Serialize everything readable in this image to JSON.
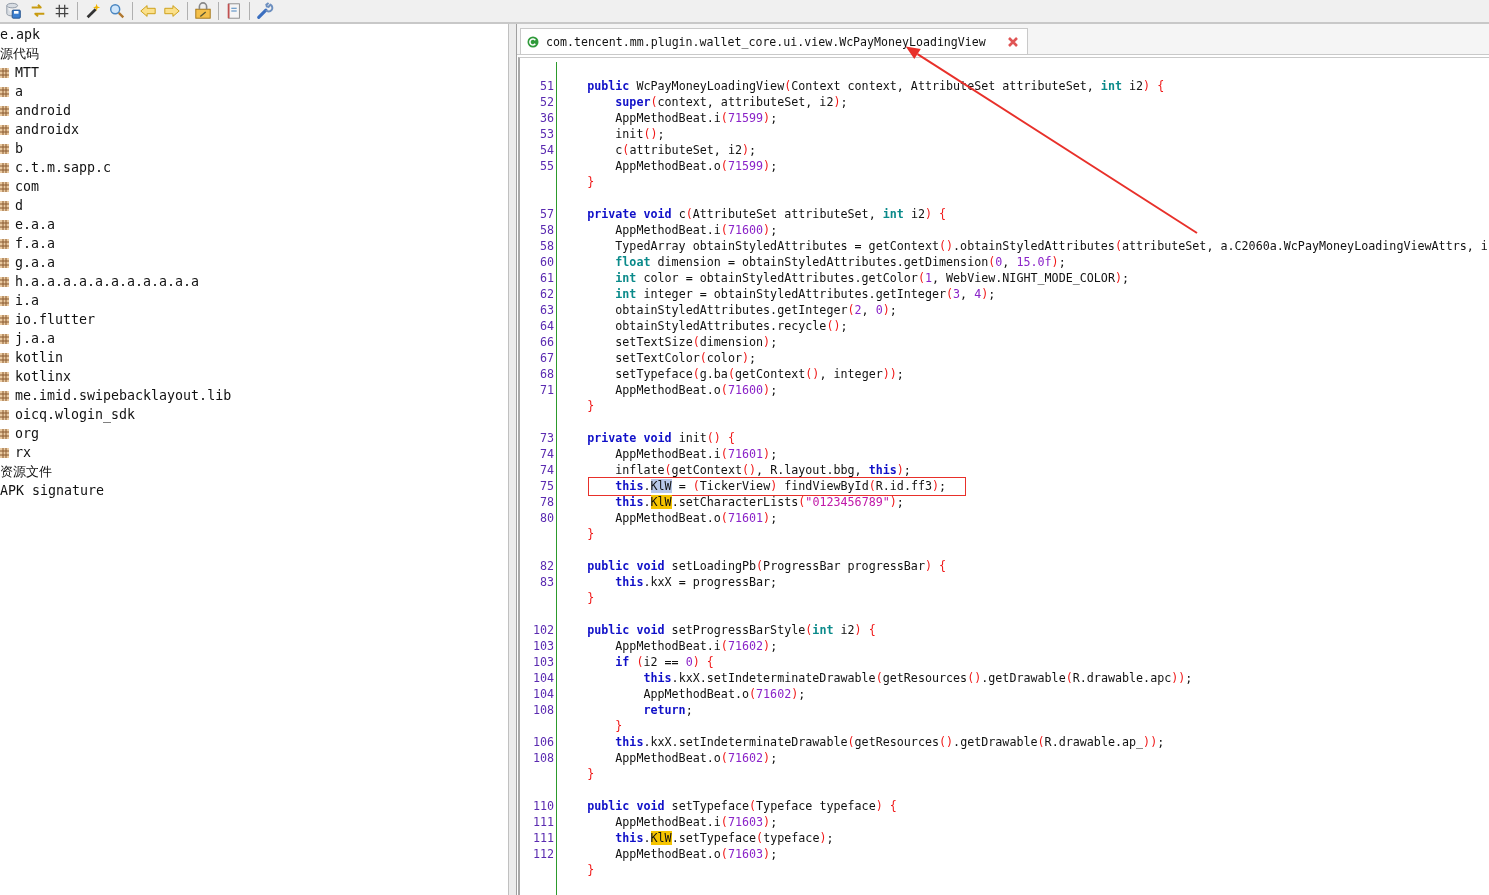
{
  "toolbar": {
    "buttons": [
      {
        "kind": "save"
      },
      {
        "kind": "sync"
      },
      {
        "kind": "grid"
      },
      {
        "kind": "sep"
      },
      {
        "kind": "wand"
      },
      {
        "kind": "search"
      },
      {
        "kind": "sep"
      },
      {
        "kind": "back"
      },
      {
        "kind": "forward"
      },
      {
        "kind": "sep"
      },
      {
        "kind": "box"
      },
      {
        "kind": "sep"
      },
      {
        "kind": "doc"
      },
      {
        "kind": "sep"
      },
      {
        "kind": "wrench"
      }
    ]
  },
  "tree": {
    "items": [
      {
        "kind": "node",
        "label": "e.apk"
      },
      {
        "kind": "node",
        "label": "源代码"
      },
      {
        "kind": "package",
        "label": "MTT"
      },
      {
        "kind": "package",
        "label": "a"
      },
      {
        "kind": "package",
        "label": "android"
      },
      {
        "kind": "package",
        "label": "androidx"
      },
      {
        "kind": "package",
        "label": "b"
      },
      {
        "kind": "package",
        "label": "c.t.m.sapp.c"
      },
      {
        "kind": "package",
        "label": "com"
      },
      {
        "kind": "package",
        "label": "d"
      },
      {
        "kind": "package",
        "label": "e.a.a"
      },
      {
        "kind": "package",
        "label": "f.a.a"
      },
      {
        "kind": "package",
        "label": "g.a.a"
      },
      {
        "kind": "package",
        "label": "h.a.a.a.a.a.a.a.a.a.a.a"
      },
      {
        "kind": "package",
        "label": "i.a"
      },
      {
        "kind": "package",
        "label": "io.flutter"
      },
      {
        "kind": "package",
        "label": "j.a.a"
      },
      {
        "kind": "package",
        "label": "kotlin"
      },
      {
        "kind": "package",
        "label": "kotlinx"
      },
      {
        "kind": "package",
        "label": "me.imid.swipebacklayout.lib"
      },
      {
        "kind": "package",
        "label": "oicq.wlogin_sdk"
      },
      {
        "kind": "package",
        "label": "org"
      },
      {
        "kind": "package",
        "label": "rx"
      },
      {
        "kind": "node",
        "label": "资源文件"
      },
      {
        "kind": "node",
        "label": "APK signature"
      }
    ]
  },
  "tabs": [
    {
      "title": "com.tencent.mm.plugin.wallet_core.ui.view.WcPayMoneyLoadingView",
      "selected": true,
      "arrow": true
    }
  ],
  "code": {
    "lines": [
      {
        "kind": "blank"
      },
      {
        "kind": "code",
        "num": "51",
        "tokens": [
          {
            "kind": "kw",
            "text": "    public"
          },
          {
            "kind": "plain",
            "text": " WcPayMoneyLoadingView"
          },
          {
            "kind": "paren",
            "text": "("
          },
          {
            "kind": "plain",
            "text": "Context context, AttributeSet attributeSet, "
          },
          {
            "kind": "type",
            "text": "int"
          },
          {
            "kind": "plain",
            "text": " i2"
          },
          {
            "kind": "paren",
            "text": ") {"
          }
        ]
      },
      {
        "kind": "code",
        "num": "52",
        "tokens": [
          {
            "kind": "kw",
            "text": "        super"
          },
          {
            "kind": "paren",
            "text": "("
          },
          {
            "kind": "plain",
            "text": "context, attributeSet, i2"
          },
          {
            "kind": "paren",
            "text": ")"
          },
          {
            "kind": "plain",
            "text": ";"
          }
        ]
      },
      {
        "kind": "code",
        "num": "36",
        "tokens": [
          {
            "kind": "plain",
            "text": "        AppMethodBeat.i"
          },
          {
            "kind": "paren",
            "text": "("
          },
          {
            "kind": "num",
            "text": "71599"
          },
          {
            "kind": "paren",
            "text": ")"
          },
          {
            "kind": "plain",
            "text": ";"
          }
        ]
      },
      {
        "kind": "code",
        "num": "53",
        "tokens": [
          {
            "kind": "plain",
            "text": "        init"
          },
          {
            "kind": "paren",
            "text": "()"
          },
          {
            "kind": "plain",
            "text": ";"
          }
        ]
      },
      {
        "kind": "code",
        "num": "54",
        "tokens": [
          {
            "kind": "plain",
            "text": "        c"
          },
          {
            "kind": "paren",
            "text": "("
          },
          {
            "kind": "plain",
            "text": "attributeSet, i2"
          },
          {
            "kind": "paren",
            "text": ")"
          },
          {
            "kind": "plain",
            "text": ";"
          }
        ]
      },
      {
        "kind": "code",
        "num": "55",
        "tokens": [
          {
            "kind": "plain",
            "text": "        AppMethodBeat.o"
          },
          {
            "kind": "paren",
            "text": "("
          },
          {
            "kind": "num",
            "text": "71599"
          },
          {
            "kind": "paren",
            "text": ")"
          },
          {
            "kind": "plain",
            "text": ";"
          }
        ]
      },
      {
        "kind": "code",
        "tokens": [
          {
            "kind": "paren",
            "text": "    }"
          }
        ]
      },
      {
        "kind": "blank"
      },
      {
        "kind": "code",
        "num": "57",
        "tokens": [
          {
            "kind": "kw",
            "text": "    private void"
          },
          {
            "kind": "plain",
            "text": " c"
          },
          {
            "kind": "paren",
            "text": "("
          },
          {
            "kind": "plain",
            "text": "AttributeSet attributeSet, "
          },
          {
            "kind": "type",
            "text": "int"
          },
          {
            "kind": "plain",
            "text": " i2"
          },
          {
            "kind": "paren",
            "text": ") {"
          }
        ]
      },
      {
        "kind": "code",
        "num": "58",
        "tokens": [
          {
            "kind": "plain",
            "text": "        AppMethodBeat.i"
          },
          {
            "kind": "paren",
            "text": "("
          },
          {
            "kind": "num",
            "text": "71600"
          },
          {
            "kind": "paren",
            "text": ")"
          },
          {
            "kind": "plain",
            "text": ";"
          }
        ]
      },
      {
        "kind": "code",
        "num": "58",
        "tokens": [
          {
            "kind": "plain",
            "text": "        TypedArray obtainStyledAttributes = getContext"
          },
          {
            "kind": "paren",
            "text": "()"
          },
          {
            "kind": "plain",
            "text": ".obtainStyledAttributes"
          },
          {
            "kind": "paren",
            "text": "("
          },
          {
            "kind": "plain",
            "text": "attributeSet, a.C2060a.WcPayMoneyLoadingViewAttrs, i"
          }
        ]
      },
      {
        "kind": "code",
        "num": "60",
        "tokens": [
          {
            "kind": "type",
            "text": "        float"
          },
          {
            "kind": "plain",
            "text": " dimension = obtainStyledAttributes.getDimension"
          },
          {
            "kind": "paren",
            "text": "("
          },
          {
            "kind": "num",
            "text": "0"
          },
          {
            "kind": "plain",
            "text": ", "
          },
          {
            "kind": "num",
            "text": "15.0f"
          },
          {
            "kind": "paren",
            "text": ")"
          },
          {
            "kind": "plain",
            "text": ";"
          }
        ]
      },
      {
        "kind": "code",
        "num": "61",
        "tokens": [
          {
            "kind": "type",
            "text": "        int"
          },
          {
            "kind": "plain",
            "text": " color = obtainStyledAttributes.getColor"
          },
          {
            "kind": "paren",
            "text": "("
          },
          {
            "kind": "num",
            "text": "1"
          },
          {
            "kind": "plain",
            "text": ", WebView.NIGHT_MODE_COLOR"
          },
          {
            "kind": "paren",
            "text": ")"
          },
          {
            "kind": "plain",
            "text": ";"
          }
        ]
      },
      {
        "kind": "code",
        "num": "62",
        "tokens": [
          {
            "kind": "type",
            "text": "        int"
          },
          {
            "kind": "plain",
            "text": " integer = obtainStyledAttributes.getInteger"
          },
          {
            "kind": "paren",
            "text": "("
          },
          {
            "kind": "num",
            "text": "3"
          },
          {
            "kind": "plain",
            "text": ", "
          },
          {
            "kind": "num",
            "text": "4"
          },
          {
            "kind": "paren",
            "text": ")"
          },
          {
            "kind": "plain",
            "text": ";"
          }
        ]
      },
      {
        "kind": "code",
        "num": "63",
        "tokens": [
          {
            "kind": "plain",
            "text": "        obtainStyledAttributes.getInteger"
          },
          {
            "kind": "paren",
            "text": "("
          },
          {
            "kind": "num",
            "text": "2"
          },
          {
            "kind": "plain",
            "text": ", "
          },
          {
            "kind": "num",
            "text": "0"
          },
          {
            "kind": "paren",
            "text": ")"
          },
          {
            "kind": "plain",
            "text": ";"
          }
        ]
      },
      {
        "kind": "code",
        "num": "64",
        "tokens": [
          {
            "kind": "plain",
            "text": "        obtainStyledAttributes.recycle"
          },
          {
            "kind": "paren",
            "text": "()"
          },
          {
            "kind": "plain",
            "text": ";"
          }
        ]
      },
      {
        "kind": "code",
        "num": "66",
        "tokens": [
          {
            "kind": "plain",
            "text": "        setTextSize"
          },
          {
            "kind": "paren",
            "text": "("
          },
          {
            "kind": "plain",
            "text": "dimension"
          },
          {
            "kind": "paren",
            "text": ")"
          },
          {
            "kind": "plain",
            "text": ";"
          }
        ]
      },
      {
        "kind": "code",
        "num": "67",
        "tokens": [
          {
            "kind": "plain",
            "text": "        setTextColor"
          },
          {
            "kind": "paren",
            "text": "("
          },
          {
            "kind": "plain",
            "text": "color"
          },
          {
            "kind": "paren",
            "text": ")"
          },
          {
            "kind": "plain",
            "text": ";"
          }
        ]
      },
      {
        "kind": "code",
        "num": "68",
        "tokens": [
          {
            "kind": "plain",
            "text": "        setTypeface"
          },
          {
            "kind": "paren",
            "text": "("
          },
          {
            "kind": "plain",
            "text": "g.ba"
          },
          {
            "kind": "paren",
            "text": "("
          },
          {
            "kind": "plain",
            "text": "getContext"
          },
          {
            "kind": "paren",
            "text": "()"
          },
          {
            "kind": "plain",
            "text": ", integer"
          },
          {
            "kind": "paren",
            "text": "))"
          },
          {
            "kind": "plain",
            "text": ";"
          }
        ]
      },
      {
        "kind": "code",
        "num": "71",
        "tokens": [
          {
            "kind": "plain",
            "text": "        AppMethodBeat.o"
          },
          {
            "kind": "paren",
            "text": "("
          },
          {
            "kind": "num",
            "text": "71600"
          },
          {
            "kind": "paren",
            "text": ")"
          },
          {
            "kind": "plain",
            "text": ";"
          }
        ]
      },
      {
        "kind": "code",
        "tokens": [
          {
            "kind": "paren",
            "text": "    }"
          }
        ]
      },
      {
        "kind": "blank"
      },
      {
        "kind": "code",
        "num": "73",
        "tokens": [
          {
            "kind": "kw",
            "text": "    private void"
          },
          {
            "kind": "plain",
            "text": " init"
          },
          {
            "kind": "paren",
            "text": "() {"
          }
        ]
      },
      {
        "kind": "code",
        "num": "74",
        "tokens": [
          {
            "kind": "plain",
            "text": "        AppMethodBeat.i"
          },
          {
            "kind": "paren",
            "text": "("
          },
          {
            "kind": "num",
            "text": "71601"
          },
          {
            "kind": "paren",
            "text": ")"
          },
          {
            "kind": "plain",
            "text": ";"
          }
        ]
      },
      {
        "kind": "code",
        "num": "74",
        "tokens": [
          {
            "kind": "plain",
            "text": "        inflate"
          },
          {
            "kind": "paren",
            "text": "("
          },
          {
            "kind": "plain",
            "text": "getContext"
          },
          {
            "kind": "paren",
            "text": "()"
          },
          {
            "kind": "plain",
            "text": ", R.layout.bbg, "
          },
          {
            "kind": "kw",
            "text": "this"
          },
          {
            "kind": "paren",
            "text": ")"
          },
          {
            "kind": "plain",
            "text": ";"
          }
        ]
      },
      {
        "kind": "code",
        "num": "75",
        "boxed": true,
        "tokens": [
          {
            "kind": "kw",
            "text": "        this"
          },
          {
            "kind": "plain",
            "text": "."
          },
          {
            "kind": "sel",
            "text": "KlW"
          },
          {
            "kind": "plain",
            "text": " = "
          },
          {
            "kind": "paren",
            "text": "("
          },
          {
            "kind": "plain",
            "text": "TickerView"
          },
          {
            "kind": "paren",
            "text": ")"
          },
          {
            "kind": "plain",
            "text": " findViewById"
          },
          {
            "kind": "paren",
            "text": "("
          },
          {
            "kind": "plain",
            "text": "R.id.ff3"
          },
          {
            "kind": "paren",
            "text": ")"
          },
          {
            "kind": "plain",
            "text": ";"
          }
        ]
      },
      {
        "kind": "code",
        "num": "78",
        "tokens": [
          {
            "kind": "kw",
            "text": "        this"
          },
          {
            "kind": "plain",
            "text": "."
          },
          {
            "kind": "mark",
            "text": "KlW"
          },
          {
            "kind": "plain",
            "text": ".setCharacterLists"
          },
          {
            "kind": "paren",
            "text": "("
          },
          {
            "kind": "str",
            "text": "\"0123456789\""
          },
          {
            "kind": "paren",
            "text": ")"
          },
          {
            "kind": "plain",
            "text": ";"
          }
        ]
      },
      {
        "kind": "code",
        "num": "80",
        "tokens": [
          {
            "kind": "plain",
            "text": "        AppMethodBeat.o"
          },
          {
            "kind": "paren",
            "text": "("
          },
          {
            "kind": "num",
            "text": "71601"
          },
          {
            "kind": "paren",
            "text": ")"
          },
          {
            "kind": "plain",
            "text": ";"
          }
        ]
      },
      {
        "kind": "code",
        "tokens": [
          {
            "kind": "paren",
            "text": "    }"
          }
        ]
      },
      {
        "kind": "blank"
      },
      {
        "kind": "code",
        "num": "82",
        "tokens": [
          {
            "kind": "kw",
            "text": "    public void"
          },
          {
            "kind": "plain",
            "text": " setLoadingPb"
          },
          {
            "kind": "paren",
            "text": "("
          },
          {
            "kind": "plain",
            "text": "ProgressBar progressBar"
          },
          {
            "kind": "paren",
            "text": ") {"
          }
        ]
      },
      {
        "kind": "code",
        "num": "83",
        "tokens": [
          {
            "kind": "kw",
            "text": "        this"
          },
          {
            "kind": "plain",
            "text": ".kxX = progressBar;"
          }
        ]
      },
      {
        "kind": "code",
        "tokens": [
          {
            "kind": "paren",
            "text": "    }"
          }
        ]
      },
      {
        "kind": "blank"
      },
      {
        "kind": "code",
        "num": "102",
        "tokens": [
          {
            "kind": "kw",
            "text": "    public void"
          },
          {
            "kind": "plain",
            "text": " setProgressBarStyle"
          },
          {
            "kind": "paren",
            "text": "("
          },
          {
            "kind": "type",
            "text": "int"
          },
          {
            "kind": "plain",
            "text": " i2"
          },
          {
            "kind": "paren",
            "text": ") {"
          }
        ]
      },
      {
        "kind": "code",
        "num": "103",
        "tokens": [
          {
            "kind": "plain",
            "text": "        AppMethodBeat.i"
          },
          {
            "kind": "paren",
            "text": "("
          },
          {
            "kind": "num",
            "text": "71602"
          },
          {
            "kind": "paren",
            "text": ")"
          },
          {
            "kind": "plain",
            "text": ";"
          }
        ]
      },
      {
        "kind": "code",
        "num": "103",
        "tokens": [
          {
            "kind": "kw",
            "text": "        if"
          },
          {
            "kind": "paren",
            "text": " ("
          },
          {
            "kind": "plain",
            "text": "i2 == "
          },
          {
            "kind": "num",
            "text": "0"
          },
          {
            "kind": "paren",
            "text": ") {"
          }
        ]
      },
      {
        "kind": "code",
        "num": "104",
        "tokens": [
          {
            "kind": "kw",
            "text": "            this"
          },
          {
            "kind": "plain",
            "text": ".kxX.setIndeterminateDrawable"
          },
          {
            "kind": "paren",
            "text": "("
          },
          {
            "kind": "plain",
            "text": "getResources"
          },
          {
            "kind": "paren",
            "text": "()"
          },
          {
            "kind": "plain",
            "text": ".getDrawable"
          },
          {
            "kind": "paren",
            "text": "("
          },
          {
            "kind": "plain",
            "text": "R.drawable.apc"
          },
          {
            "kind": "paren",
            "text": "))"
          },
          {
            "kind": "plain",
            "text": ";"
          }
        ]
      },
      {
        "kind": "code",
        "num": "104",
        "tokens": [
          {
            "kind": "plain",
            "text": "            AppMethodBeat.o"
          },
          {
            "kind": "paren",
            "text": "("
          },
          {
            "kind": "num",
            "text": "71602"
          },
          {
            "kind": "paren",
            "text": ")"
          },
          {
            "kind": "plain",
            "text": ";"
          }
        ]
      },
      {
        "kind": "code",
        "num": "108",
        "tokens": [
          {
            "kind": "kw",
            "text": "            return"
          },
          {
            "kind": "plain",
            "text": ";"
          }
        ]
      },
      {
        "kind": "code",
        "tokens": [
          {
            "kind": "paren",
            "text": "        }"
          }
        ]
      },
      {
        "kind": "code",
        "num": "106",
        "tokens": [
          {
            "kind": "kw",
            "text": "        this"
          },
          {
            "kind": "plain",
            "text": ".kxX.setIndeterminateDrawable"
          },
          {
            "kind": "paren",
            "text": "("
          },
          {
            "kind": "plain",
            "text": "getResources"
          },
          {
            "kind": "paren",
            "text": "()"
          },
          {
            "kind": "plain",
            "text": ".getDrawable"
          },
          {
            "kind": "paren",
            "text": "("
          },
          {
            "kind": "plain",
            "text": "R.drawable.ap_"
          },
          {
            "kind": "paren",
            "text": "))"
          },
          {
            "kind": "plain",
            "text": ";"
          }
        ]
      },
      {
        "kind": "code",
        "num": "108",
        "tokens": [
          {
            "kind": "plain",
            "text": "        AppMethodBeat.o"
          },
          {
            "kind": "paren",
            "text": "("
          },
          {
            "kind": "num",
            "text": "71602"
          },
          {
            "kind": "paren",
            "text": ")"
          },
          {
            "kind": "plain",
            "text": ";"
          }
        ]
      },
      {
        "kind": "code",
        "tokens": [
          {
            "kind": "paren",
            "text": "    }"
          }
        ]
      },
      {
        "kind": "blank"
      },
      {
        "kind": "code",
        "num": "110",
        "tokens": [
          {
            "kind": "kw",
            "text": "    public void"
          },
          {
            "kind": "plain",
            "text": " setTypeface"
          },
          {
            "kind": "paren",
            "text": "("
          },
          {
            "kind": "plain",
            "text": "Typeface typeface"
          },
          {
            "kind": "paren",
            "text": ") {"
          }
        ]
      },
      {
        "kind": "code",
        "num": "111",
        "tokens": [
          {
            "kind": "plain",
            "text": "        AppMethodBeat.i"
          },
          {
            "kind": "paren",
            "text": "("
          },
          {
            "kind": "num",
            "text": "71603"
          },
          {
            "kind": "paren",
            "text": ")"
          },
          {
            "kind": "plain",
            "text": ";"
          }
        ]
      },
      {
        "kind": "code",
        "num": "111",
        "tokens": [
          {
            "kind": "kw",
            "text": "        this"
          },
          {
            "kind": "plain",
            "text": "."
          },
          {
            "kind": "mark",
            "text": "KlW"
          },
          {
            "kind": "plain",
            "text": ".setTypeface"
          },
          {
            "kind": "paren",
            "text": "("
          },
          {
            "kind": "plain",
            "text": "typeface"
          },
          {
            "kind": "paren",
            "text": ")"
          },
          {
            "kind": "plain",
            "text": ";"
          }
        ]
      },
      {
        "kind": "code",
        "num": "112",
        "tokens": [
          {
            "kind": "plain",
            "text": "        AppMethodBeat.o"
          },
          {
            "kind": "paren",
            "text": "("
          },
          {
            "kind": "num",
            "text": "71603"
          },
          {
            "kind": "paren",
            "text": ")"
          },
          {
            "kind": "plain",
            "text": ";"
          }
        ]
      },
      {
        "kind": "code",
        "tokens": [
          {
            "kind": "paren",
            "text": "    }"
          }
        ]
      }
    ]
  }
}
